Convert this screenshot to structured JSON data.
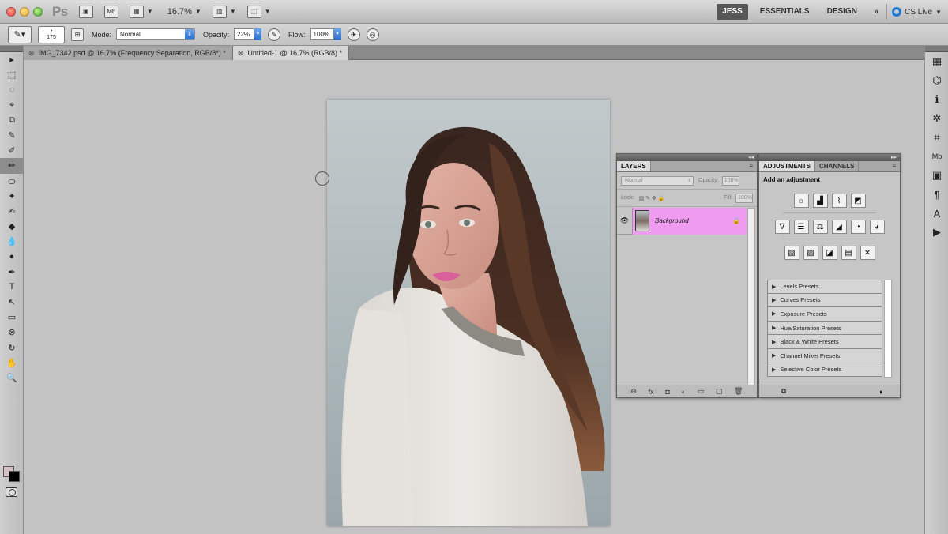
{
  "appbar": {
    "logo": "Ps",
    "br_label": "▣",
    "mb_label": "Mb",
    "zoom": "16.7%",
    "workspaces": [
      "JESS",
      "ESSENTIALS",
      "DESIGN"
    ],
    "more": "»",
    "cslive": "CS Live"
  },
  "options": {
    "brush_size": "175",
    "mode_label": "Mode:",
    "mode_value": "Normal",
    "opacity_label": "Opacity:",
    "opacity_value": "22%",
    "flow_label": "Flow:",
    "flow_value": "100%"
  },
  "tabs": [
    {
      "close": "⊗",
      "label": "IMG_7342.psd @ 16.7% (Frequency Separation, RGB/8*) *"
    },
    {
      "close": "⊗",
      "label": "Untitled-1 @ 16.7% (RGB/8) *"
    }
  ],
  "tools": [
    "▸",
    "⬚",
    "◌",
    "⌖",
    "⧉",
    "✎",
    "✐",
    "✏",
    "⛀",
    "✦",
    "✍",
    "◆",
    "💧",
    "●",
    "✒",
    "T",
    "↖",
    "▭",
    "⊗",
    "↻",
    "✋",
    "🔍"
  ],
  "dock": [
    "▦",
    "⌬",
    "ℹ",
    "✲",
    "⌗",
    "Mb",
    "▣",
    "¶",
    "A",
    "▶"
  ],
  "layers_panel": {
    "tab": "LAYERS",
    "menu": "≡",
    "blend": "Normal",
    "opacity_label": "Opacity:",
    "opacity_value": "100%",
    "lock_label": "Lock:",
    "lock_icons": "▨ ✎ ✥ 🔒",
    "fill_label": "Fill:",
    "fill_value": "100%",
    "eye": "👁",
    "layer_name": "Background",
    "lock_glyph": "🔒",
    "footer": [
      "⊖",
      "fx",
      "◘",
      "◐",
      "▭",
      "▢",
      "🗑"
    ]
  },
  "adjustments_panel": {
    "tabs": [
      "ADJUSTMENTS",
      "CHANNELS"
    ],
    "menu": "≡",
    "title": "Add an adjustment",
    "row1": [
      "☼",
      "▟",
      "⌇",
      "◩"
    ],
    "row2": [
      "∇",
      "☰",
      "⚖",
      "◢",
      "◔",
      "◕"
    ],
    "row3": [
      "▧",
      "▨",
      "◪",
      "▤",
      "✕"
    ],
    "presets": [
      "Levels Presets",
      "Curves Presets",
      "Exposure Presets",
      "Hue/Saturation Presets",
      "Black & White Presets",
      "Channel Mixer Presets",
      "Selective Color Presets"
    ],
    "footer_left": "⧉",
    "footer_right": "◑"
  }
}
